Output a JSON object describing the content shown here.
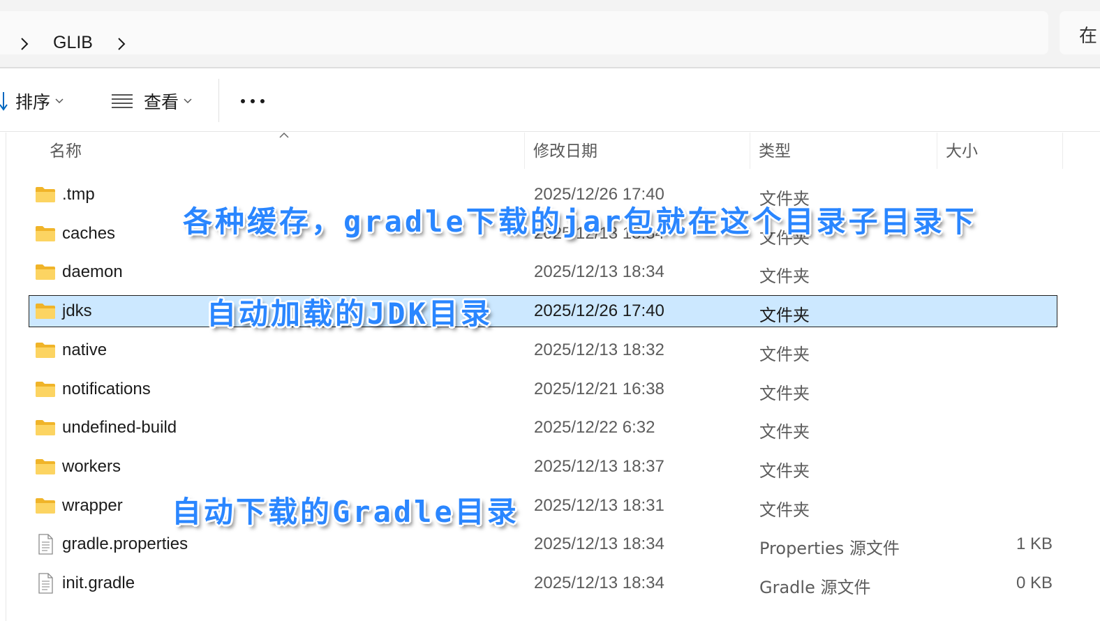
{
  "address_bar": {
    "breadcrumbs": [
      "GLIB"
    ],
    "search_text": "在"
  },
  "commands": {
    "sort_label": "排序",
    "view_label": "查看",
    "more_label": "•••"
  },
  "columns": {
    "name": "名称",
    "date": "修改日期",
    "type": "类型",
    "size": "大小"
  },
  "files": [
    {
      "name": ".tmp",
      "date": "2025/12/26 17:40",
      "type": "文件夹",
      "size": "",
      "icon": "folder-icon"
    },
    {
      "name": "caches",
      "date": "2025/12/13 18:34",
      "type": "文件夹",
      "size": "",
      "icon": "folder-icon"
    },
    {
      "name": "daemon",
      "date": "2025/12/13 18:34",
      "type": "文件夹",
      "size": "",
      "icon": "folder-icon"
    },
    {
      "name": "jdks",
      "date": "2025/12/26 17:40",
      "type": "文件夹",
      "size": "",
      "icon": "folder-icon",
      "selected": true
    },
    {
      "name": "native",
      "date": "2025/12/13 18:32",
      "type": "文件夹",
      "size": "",
      "icon": "folder-icon"
    },
    {
      "name": "notifications",
      "date": "2025/12/21 16:38",
      "type": "文件夹",
      "size": "",
      "icon": "folder-icon"
    },
    {
      "name": "undefined-build",
      "date": "2025/12/22 6:32",
      "type": "文件夹",
      "size": "",
      "icon": "folder-icon"
    },
    {
      "name": "workers",
      "date": "2025/12/13 18:37",
      "type": "文件夹",
      "size": "",
      "icon": "folder-icon"
    },
    {
      "name": "wrapper",
      "date": "2025/12/13 18:31",
      "type": "文件夹",
      "size": "",
      "icon": "folder-icon"
    },
    {
      "name": "gradle.properties",
      "date": "2025/12/13 18:34",
      "type": "Properties 源文件",
      "size": "1 KB",
      "icon": "file-icon"
    },
    {
      "name": "init.gradle",
      "date": "2025/12/13 18:34",
      "type": "Gradle 源文件",
      "size": "0 KB",
      "icon": "file-icon"
    }
  ],
  "annotations": {
    "caches_note": "各种缓存，gradle下载的jar包就在这个目录子目录下",
    "jdks_note": "自动加载的JDK目录",
    "wrapper_note": "自动下载的Gradle目录"
  },
  "colors": {
    "selection": "#cce8ff",
    "annotation": "#2a86ff",
    "folder": "#f8c843",
    "accent": "#0067c0"
  }
}
